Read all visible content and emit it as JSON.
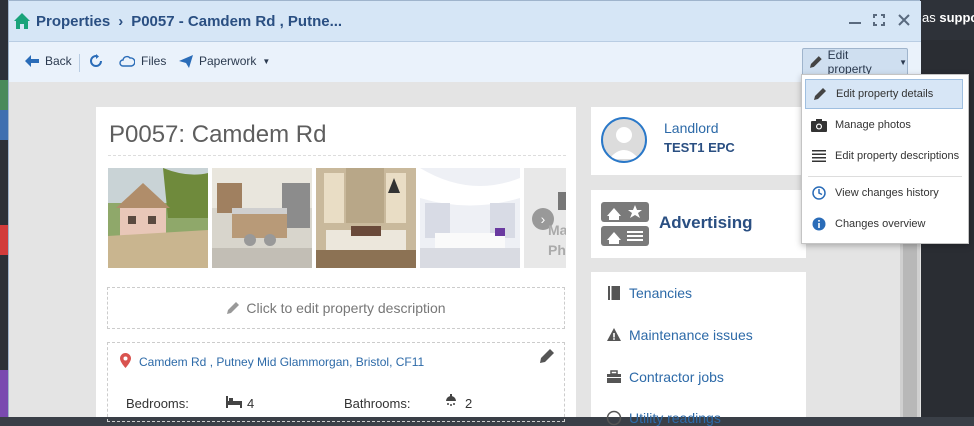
{
  "background": {
    "right_text_prefix": "as ",
    "right_text_bold": "suppo"
  },
  "window": {
    "breadcrumb_root": "Properties",
    "breadcrumb_sep": "›",
    "breadcrumb_current": "P0057 - Camdem Rd , Putne..."
  },
  "toolbar": {
    "back_label": "Back",
    "files_label": "Files",
    "paperwork_label": "Paperwork",
    "edit_property_label": "Edit property"
  },
  "dropdown": {
    "items": [
      {
        "label": "Edit property details",
        "icon": "pencil-icon"
      },
      {
        "label": "Manage photos",
        "icon": "camera-icon"
      },
      {
        "label": "Edit property descriptions",
        "icon": "list-icon"
      },
      {
        "label": "View changes history",
        "icon": "clock-icon"
      },
      {
        "label": "Changes overview",
        "icon": "info-icon"
      }
    ]
  },
  "property": {
    "title": "P0057: Camdem Rd",
    "photos_more_label": "Ma\nPh",
    "description_placeholder": "Click to edit property description",
    "address": "Camdem Rd , Putney Mid Glammorgan, Bristol, CF11",
    "bedrooms_label": "Bedrooms:",
    "bedrooms_value": "4",
    "bathrooms_label": "Bathrooms:",
    "bathrooms_value": "2"
  },
  "landlord": {
    "label": "Landlord",
    "name": "TEST1 EPC"
  },
  "advertising": {
    "label": "Advertising"
  },
  "menu": {
    "tenancies": "Tenancies",
    "maintenance": "Maintenance issues",
    "contractor": "Contractor jobs",
    "utility": "Utility readings"
  },
  "colors": {
    "accent": "#2d6aa8",
    "title_blue": "#2a4f82",
    "home_green": "#1aa37a",
    "pin_red": "#d9534f"
  }
}
